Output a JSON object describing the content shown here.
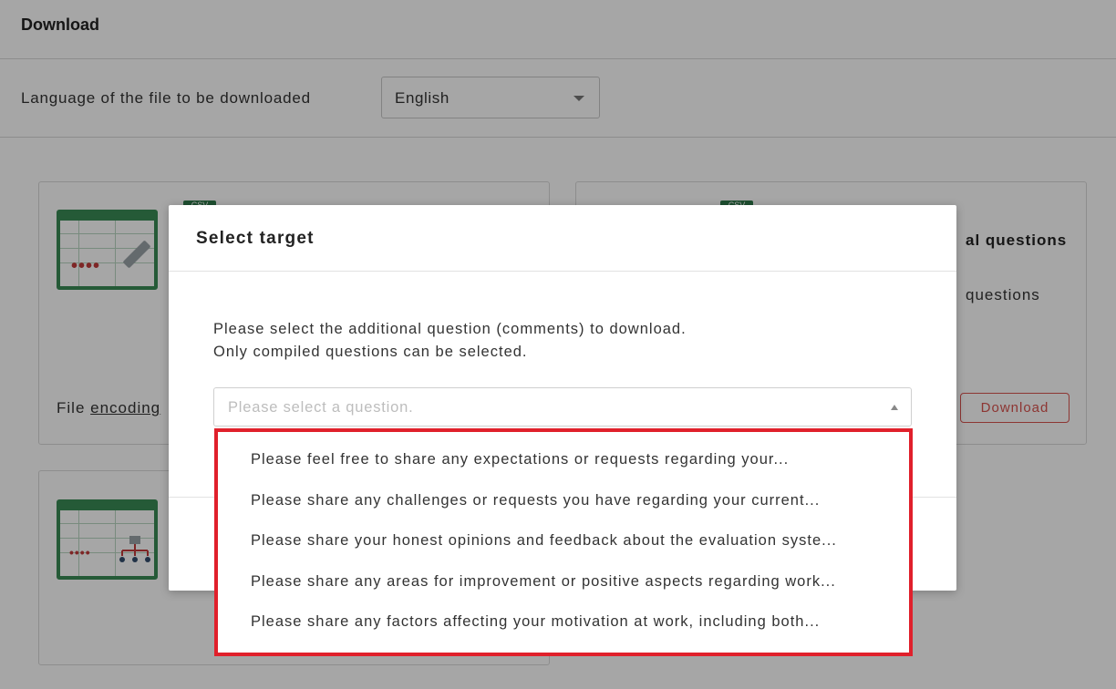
{
  "page": {
    "title": "Download",
    "language_label": "Language of the file to be downloaded",
    "language_value": "English"
  },
  "cards": {
    "csv_tag": "CSV",
    "card_a_encoding_prefix": "File ",
    "card_a_encoding_link": "encoding",
    "card_b_title": "al questions",
    "card_b_sub": "questions",
    "download_label": "Download"
  },
  "modal": {
    "title": "Select target",
    "line1": "Please select the additional question (comments) to download.",
    "line2": "Only compiled questions can be selected.",
    "select_placeholder": "Please select a question."
  },
  "dropdown": {
    "items": [
      "Please feel free to share any expectations or requests regarding your...",
      "Please share any challenges or requests you have regarding your current...",
      "Please share your honest opinions and feedback about the evaluation syste...",
      "Please share any areas for improvement or positive aspects regarding work...",
      "Please share any factors affecting your motivation at work, including both..."
    ],
    "highlight_color": "#e0202b"
  },
  "colors": {
    "accent_green": "#3a8a55",
    "download_red": "#d9534f"
  },
  "icons": {
    "spreadsheet": "spreadsheet-icon",
    "org_chart": "org-chart-icon",
    "caret": "chevron-down-icon"
  }
}
